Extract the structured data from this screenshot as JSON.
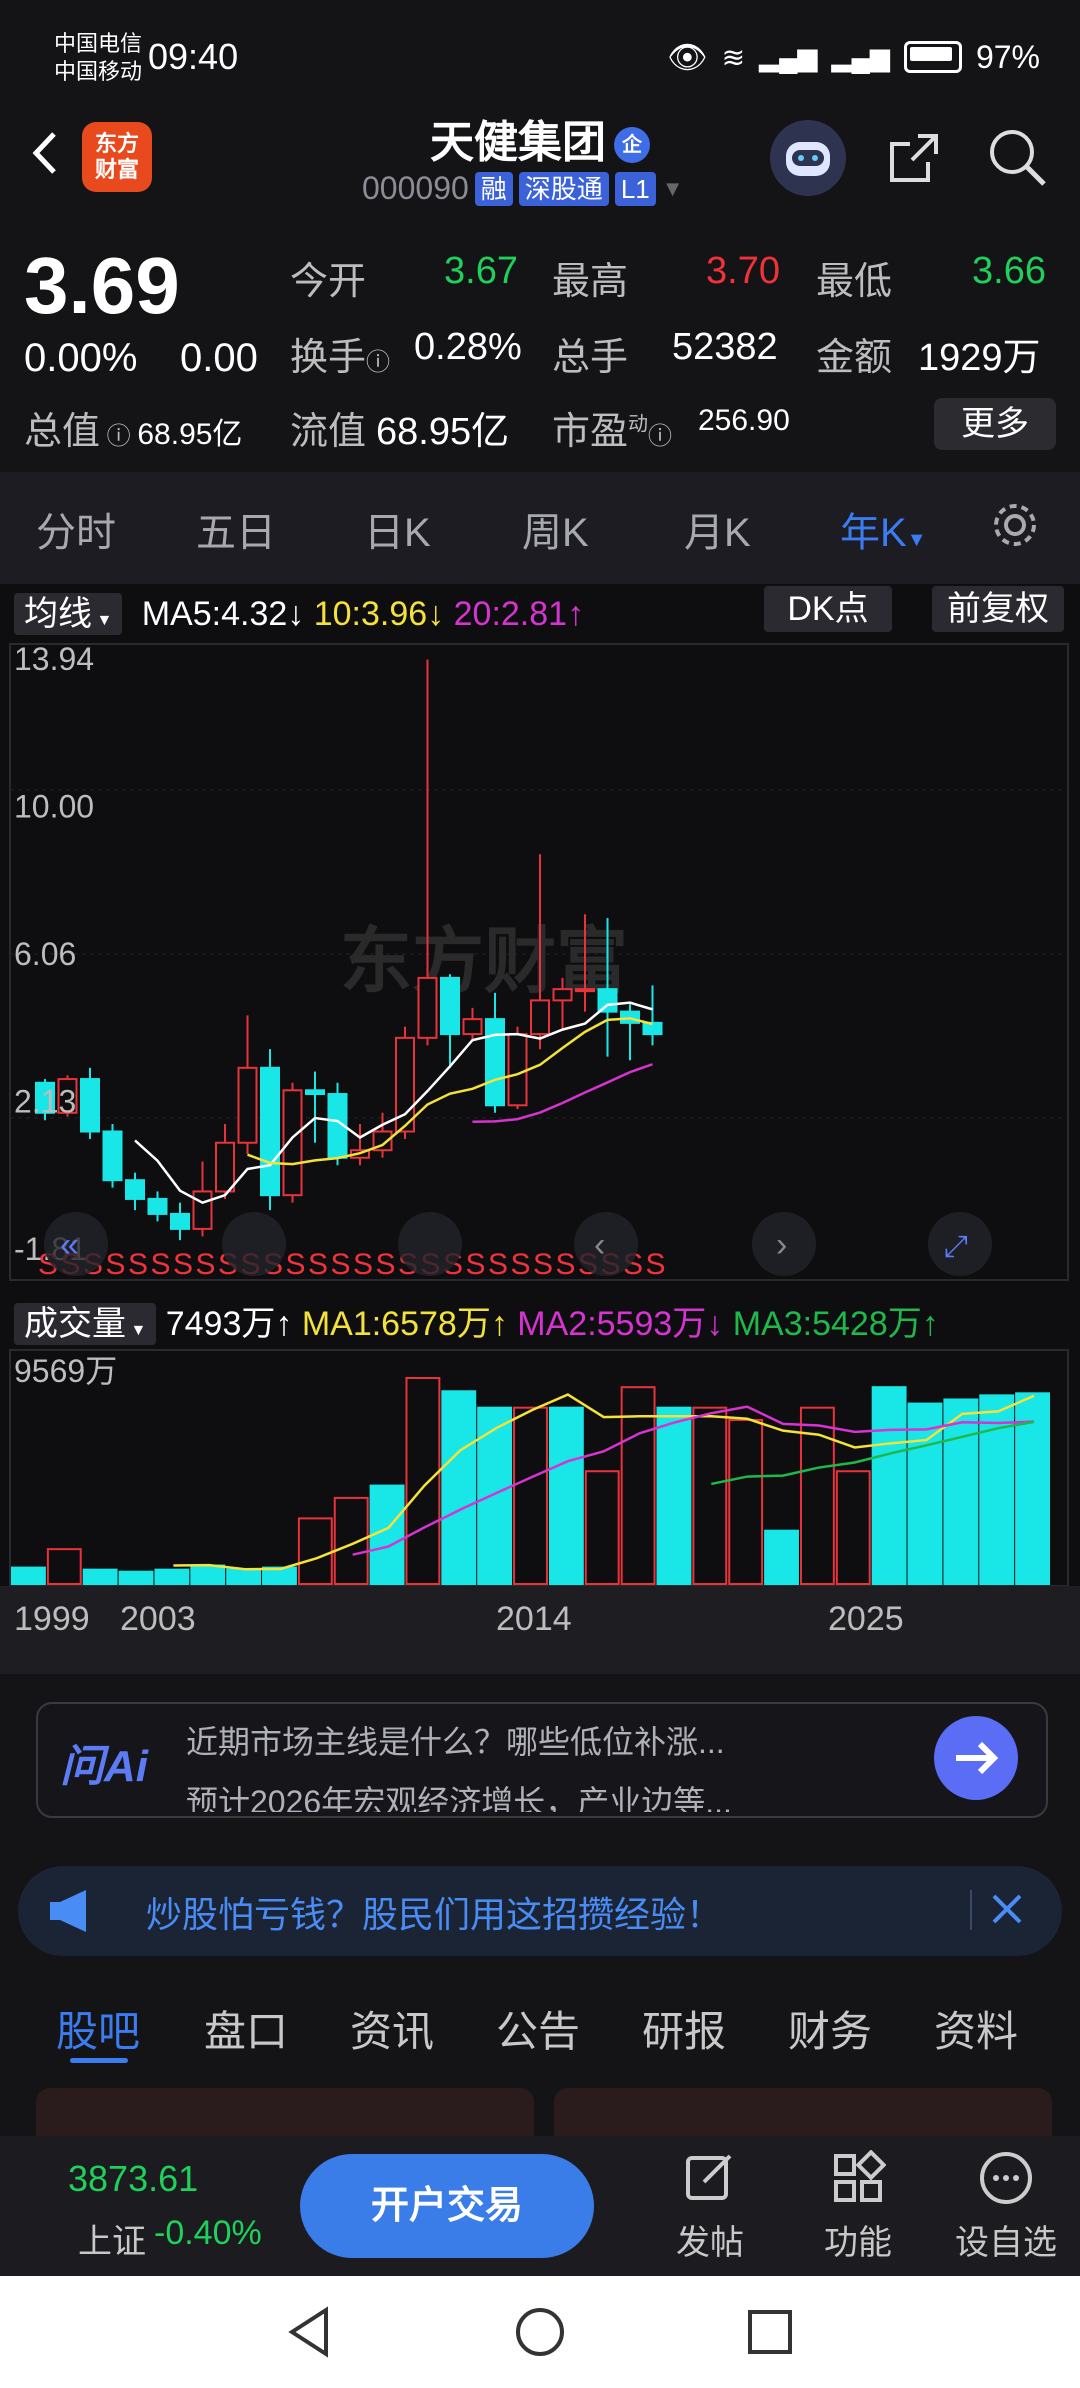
{
  "status": {
    "carrier1": "中国电信",
    "carrier2": "中国移动",
    "time": "09:40",
    "battery": "97%"
  },
  "header": {
    "logo_line1": "东方",
    "logo_line2": "财富",
    "title": "天健集团",
    "title_badge": "企",
    "code": "000090",
    "tags": [
      "融",
      "深股通",
      "L1"
    ]
  },
  "quote": {
    "price": "3.69",
    "change_pct": "0.00%",
    "change": "0.00",
    "open_label": "今开",
    "open": "3.67",
    "high_label": "最高",
    "high": "3.70",
    "low_label": "最低",
    "low": "3.66",
    "turnover_label": "换手",
    "turnover": "0.28%",
    "volume_label": "总手",
    "volume": "52382",
    "amount_label": "金额",
    "amount": "1929万",
    "mktcap_label": "总值",
    "mktcap": "68.95亿",
    "float_label": "流值",
    "float": "68.95亿",
    "pe_label": "市盈",
    "pe_sup": "动",
    "pe": "256.90",
    "more": "更多"
  },
  "tabs": [
    "分时",
    "五日",
    "日K",
    "周K",
    "月K",
    "年K"
  ],
  "chart_legend": {
    "ma_label": "均线",
    "ma5": "MA5:4.32",
    "ma10": "10:3.96",
    "ma20": "20:2.81",
    "dk": "DK点",
    "fq": "前复权",
    "vol_label": "成交量",
    "vol_value": "7493万",
    "vma1": "MA1:6578万",
    "vma2": "MA2:5593万",
    "vma3": "MA3:5428万",
    "vol_max": "9569万",
    "watermark": "东方财富"
  },
  "chart_data": {
    "type": "candlestick",
    "price_axis_labels": [
      "13.94",
      "10.00",
      "6.06",
      "2.13",
      "-1.81"
    ],
    "ylim": [
      -1.81,
      13.94
    ],
    "x_labels": [
      "1999",
      "2003",
      "2014",
      "2025"
    ],
    "candles": [
      {
        "o": 2.6,
        "c": 1.8,
        "h": 2.7,
        "l": 1.6
      },
      {
        "o": 1.8,
        "c": 2.7,
        "h": 2.8,
        "l": 1.7
      },
      {
        "o": 2.7,
        "c": 1.3,
        "h": 3.0,
        "l": 1.1
      },
      {
        "o": 1.3,
        "c": 0.0,
        "h": 1.5,
        "l": -0.2
      },
      {
        "o": 0.0,
        "c": -0.5,
        "h": 0.2,
        "l": -0.8
      },
      {
        "o": -0.5,
        "c": -0.9,
        "h": -0.3,
        "l": -1.1
      },
      {
        "o": -0.9,
        "c": -1.3,
        "h": -0.6,
        "l": -1.6
      },
      {
        "o": -1.3,
        "c": -0.3,
        "h": 0.5,
        "l": -1.5
      },
      {
        "o": -0.3,
        "c": 1.0,
        "h": 1.5,
        "l": -0.5
      },
      {
        "o": 1.0,
        "c": 3.0,
        "h": 4.4,
        "l": 0.7
      },
      {
        "o": 3.0,
        "c": -0.4,
        "h": 3.5,
        "l": -0.8
      },
      {
        "o": -0.4,
        "c": 2.4,
        "h": 2.6,
        "l": -0.6
      },
      {
        "o": 2.4,
        "c": 2.3,
        "h": 2.9,
        "l": 1.0
      },
      {
        "o": 2.3,
        "c": 0.6,
        "h": 2.6,
        "l": 0.4
      },
      {
        "o": 0.6,
        "c": 0.8,
        "h": 1.5,
        "l": 0.4
      },
      {
        "o": 0.8,
        "c": 1.3,
        "h": 1.8,
        "l": 0.6
      },
      {
        "o": 1.3,
        "c": 3.8,
        "h": 4.1,
        "l": 1.1
      },
      {
        "o": 3.8,
        "c": 5.4,
        "h": 13.9,
        "l": 3.6
      },
      {
        "o": 5.4,
        "c": 3.9,
        "h": 5.5,
        "l": 3.0
      },
      {
        "o": 3.9,
        "c": 4.3,
        "h": 4.6,
        "l": 3.7
      },
      {
        "o": 4.3,
        "c": 2.0,
        "h": 5.0,
        "l": 1.8
      },
      {
        "o": 2.0,
        "c": 3.9,
        "h": 4.1,
        "l": 1.9
      },
      {
        "o": 3.9,
        "c": 4.8,
        "h": 8.7,
        "l": 3.5
      },
      {
        "o": 4.8,
        "c": 5.1,
        "h": 5.4,
        "l": 4.0
      },
      {
        "o": 5.1,
        "c": 5.1,
        "h": 7.1,
        "l": 4.5
      },
      {
        "o": 5.1,
        "c": 4.5,
        "h": 7.0,
        "l": 3.3
      },
      {
        "o": 4.5,
        "c": 4.2,
        "h": 4.7,
        "l": 3.2
      },
      {
        "o": 4.2,
        "c": 3.9,
        "h": 5.2,
        "l": 3.6
      }
    ],
    "volume_ylim": [
      0,
      9569
    ],
    "volumes": [
      800,
      1700,
      700,
      600,
      700,
      900,
      700,
      800,
      3200,
      4200,
      4800,
      11000,
      9400,
      8600,
      8600,
      8600,
      5500,
      9600,
      8600,
      8600,
      8000,
      2600,
      8600,
      5500,
      9600,
      8800,
      9000,
      9200,
      9300
    ],
    "volume_up": [
      false,
      true,
      false,
      false,
      false,
      false,
      false,
      false,
      true,
      true,
      false,
      true,
      false,
      false,
      true,
      false,
      true,
      true,
      false,
      true,
      true,
      false,
      true,
      true,
      false,
      false,
      false,
      false,
      false
    ]
  },
  "ai": {
    "logo": "问Ai",
    "line1": "近期市场主线是什么？哪些低位补涨...",
    "line2": "预计2026年宏观经济增长，产业边等..."
  },
  "promo": {
    "text": "炒股怕亏钱？股民们用这招攒经验！"
  },
  "bottom_tabs": [
    "股吧",
    "盘口",
    "资讯",
    "公告",
    "研报",
    "财务",
    "资料"
  ],
  "bottom_bar": {
    "index_value": "3873.61",
    "index_name": "上证",
    "index_change": "-0.40%",
    "trade": "开户交易",
    "post": "发帖",
    "func": "功能",
    "watch": "设自选"
  }
}
